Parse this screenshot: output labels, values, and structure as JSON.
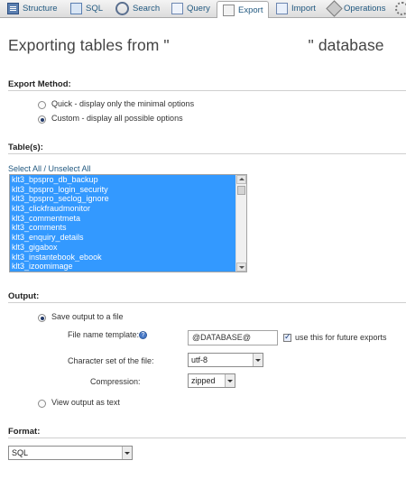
{
  "tabs": [
    {
      "label": "Structure",
      "icon": "structure-icon"
    },
    {
      "label": "SQL",
      "icon": "sql-icon"
    },
    {
      "label": "Search",
      "icon": "search-icon"
    },
    {
      "label": "Query",
      "icon": "query-icon"
    },
    {
      "label": "Export",
      "icon": "export-icon",
      "active": true
    },
    {
      "label": "Import",
      "icon": "import-icon"
    },
    {
      "label": "Operations",
      "icon": "operations-icon"
    }
  ],
  "page": {
    "title": "Exporting tables from \"                               \" database"
  },
  "export_method": {
    "heading": "Export Method:",
    "quick_label": "Quick - display only the minimal options",
    "custom_label": "Custom - display all possible options",
    "selected": "custom"
  },
  "tables": {
    "heading": "Table(s):",
    "select_all_label": "Select All / Unselect All",
    "items": [
      "klt3_bpspro_db_backup",
      "klt3_bpspro_login_security",
      "klt3_bpspro_seclog_ignore",
      "klt3_clickfraudmonitor",
      "klt3_commentmeta",
      "klt3_comments",
      "klt3_enquiry_details",
      "klt3_gigabox",
      "klt3_instantebook_ebook",
      "klt3_izoomimage"
    ]
  },
  "output": {
    "heading": "Output:",
    "save_to_file_label": "Save output to a file",
    "file_name_template_label": "File name template:",
    "file_name_template_value": "@DATABASE@",
    "use_for_future_label": "use this for future exports",
    "use_for_future_checked": true,
    "charset_label": "Character set of the file:",
    "charset_value": "utf-8",
    "compression_label": "Compression:",
    "compression_value": "zipped",
    "view_as_text_label": "View output as text",
    "selected": "save_to_file"
  },
  "format": {
    "heading": "Format:",
    "value": "SQL"
  },
  "colors": {
    "link": "#235a81",
    "selection": "#3399ff"
  }
}
